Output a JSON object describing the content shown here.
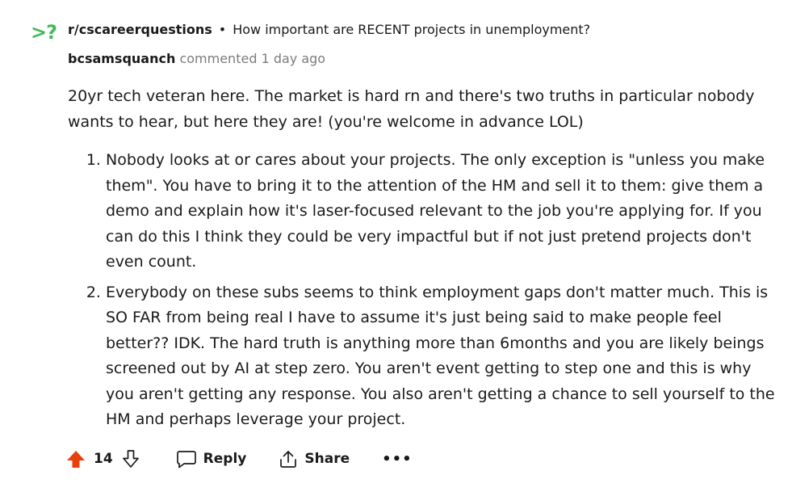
{
  "header": {
    "subreddit_icon_text": ">?",
    "subreddit": "r/cscareerquestions",
    "separator": "•",
    "post_title": "How important are RECENT projects in unemployment?"
  },
  "meta": {
    "author": "bcsamsquanch",
    "action": "commented",
    "time": "1 day ago"
  },
  "comment": {
    "intro": "20yr tech veteran here. The market is hard rn and there's two truths in particular nobody wants to hear, but here they are! (you're welcome in advance LOL)",
    "points": [
      "Nobody looks at or cares about your projects. The only exception is \"unless you make them\". You have to bring it to the attention of the HM and sell it to them: give them a demo and explain how it's laser-focused relevant to the job you're applying for. If you can do this I think they could be very impactful but if not just pretend projects don't even count.",
      "Everybody on these subs seems to think employment gaps don't matter much. This is SO FAR from being real I have to assume it's just being said to make people feel better?? IDK. The hard truth is anything more than 6months and you are likely beings screened out by AI at step zero. You aren't event getting to step one and this is why you aren't getting any response. You also aren't getting a chance to sell yourself to the HM and perhaps leverage your project."
    ]
  },
  "actions": {
    "vote_count": "14",
    "reply_label": "Reply",
    "share_label": "Share",
    "more_label": "•••"
  },
  "colors": {
    "upvote_active": "#e8400c",
    "icon_green": "#46b95a",
    "muted": "#7c7c7c"
  },
  "icons": {
    "upvote": "arrow-up-icon",
    "downvote": "arrow-down-icon",
    "reply": "speech-bubble-icon",
    "share": "share-upload-icon",
    "more": "ellipsis-icon"
  }
}
